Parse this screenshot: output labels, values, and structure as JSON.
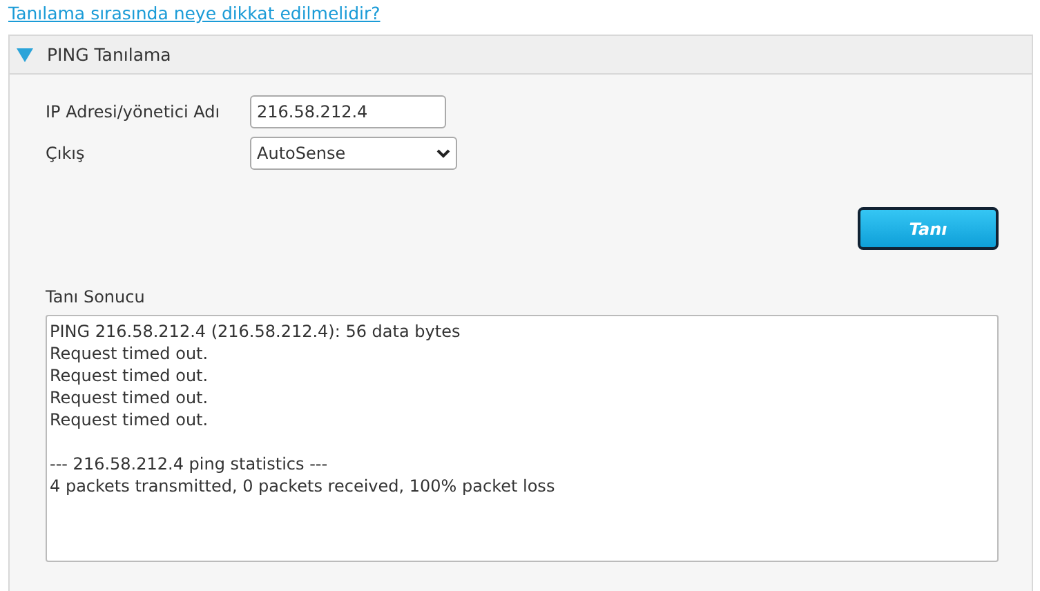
{
  "help_link": "Tanılama sırasında neye dikkat edilmelidir?",
  "panel": {
    "title": "PING Tanılama",
    "expanded": true,
    "fields": [
      {
        "kind": "text",
        "label": "IP Adresi/yönetici Adı",
        "value": "216.58.212.4"
      },
      {
        "kind": "select",
        "label": "Çıkış",
        "value": "AutoSense"
      }
    ],
    "button": "Tanı",
    "result": {
      "label": "Tanı Sonucu",
      "value": "PING 216.58.212.4 (216.58.212.4): 56 data bytes\nRequest timed out.\nRequest timed out.\nRequest timed out.\nRequest timed out.\n\n--- 216.58.212.4 ping statistics ---\n4 packets transmitted, 0 packets received, 100% packet loss"
    }
  }
}
